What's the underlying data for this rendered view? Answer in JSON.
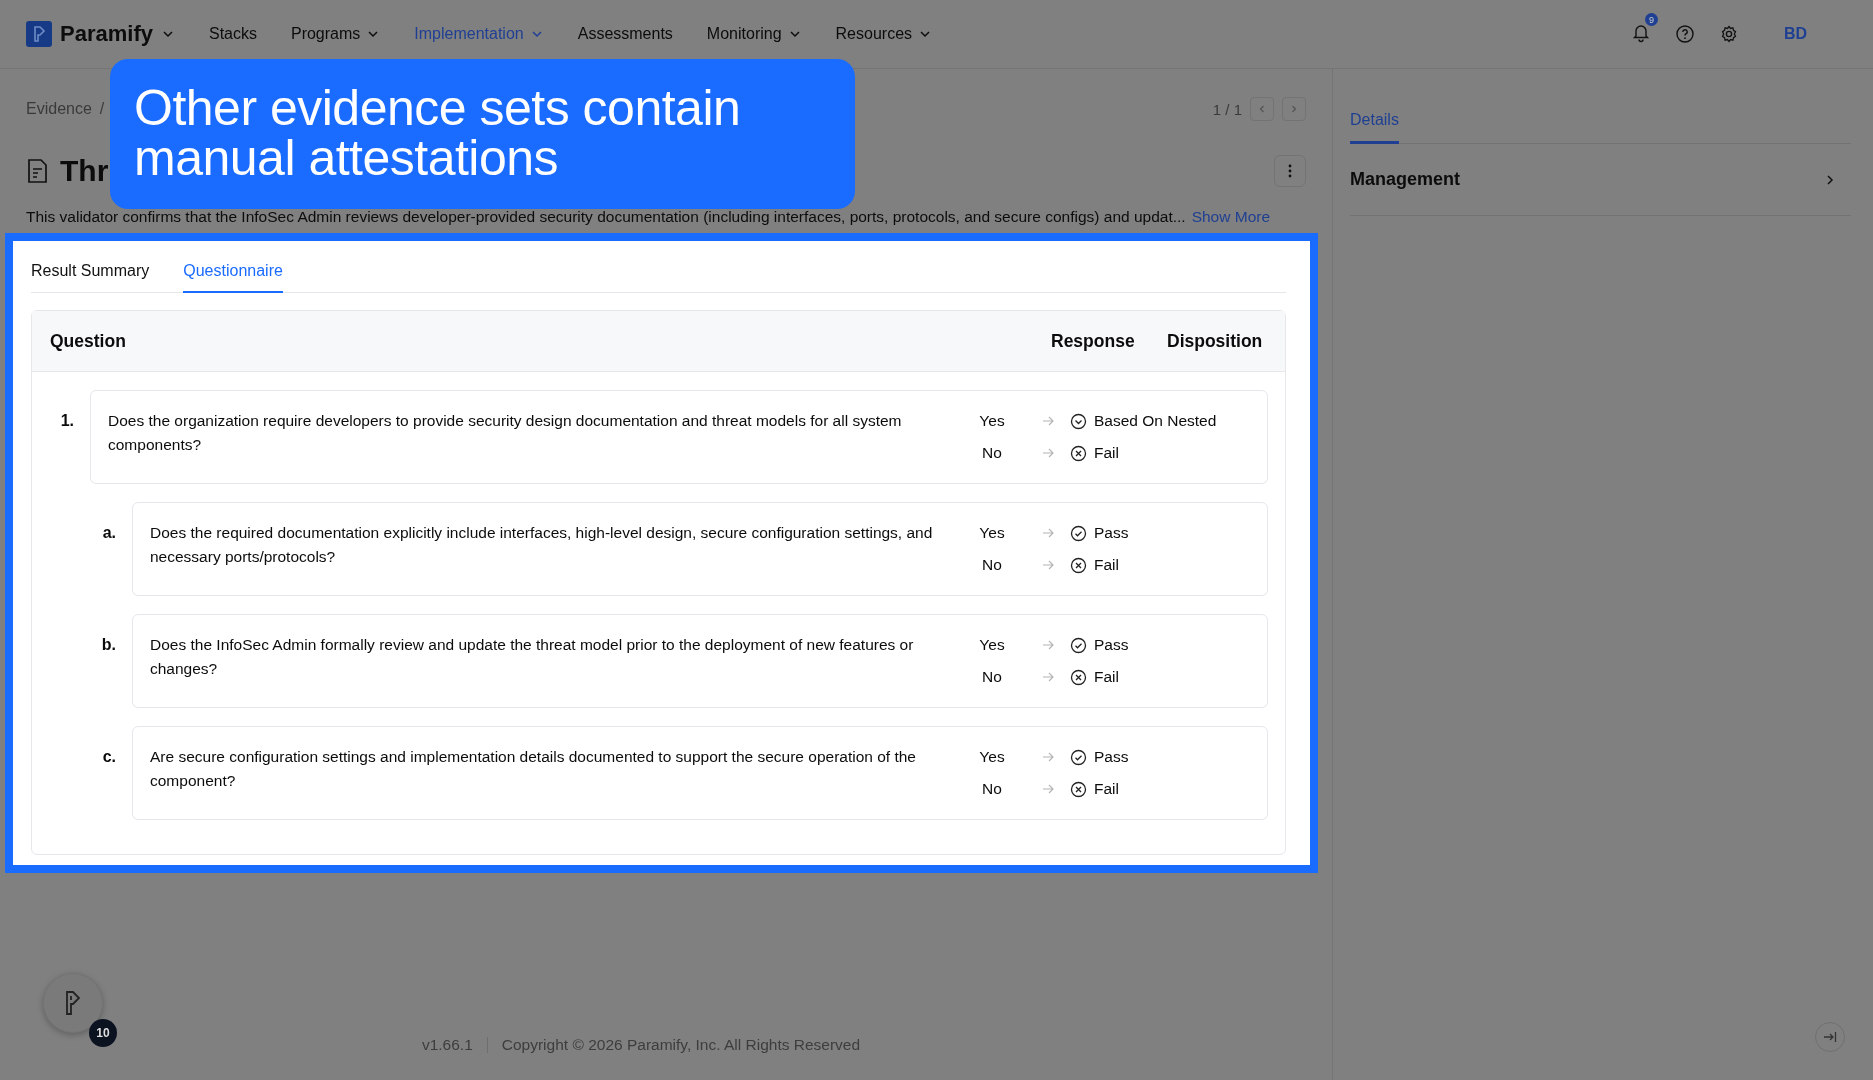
{
  "nav": {
    "brand": "Paramify",
    "items": [
      {
        "label": "Stacks",
        "dropdown": false,
        "selected": false
      },
      {
        "label": "Programs",
        "dropdown": true,
        "selected": false
      },
      {
        "label": "Implementation",
        "dropdown": true,
        "selected": true
      },
      {
        "label": "Assessments",
        "dropdown": false,
        "selected": false
      },
      {
        "label": "Monitoring",
        "dropdown": true,
        "selected": false
      },
      {
        "label": "Resources",
        "dropdown": true,
        "selected": false
      }
    ],
    "notification_count": "9",
    "avatar": "BD"
  },
  "callout": "Other evidence sets contain manual attestations",
  "breadcrumb": [
    "Evidence"
  ],
  "breadcrumb_separator": "/",
  "pager": "1 / 1",
  "title": "Thr",
  "description": "This validator confirms that the InfoSec Admin reviews developer-provided security documentation (including interfaces, ports, protocols, and secure configs) and updat...",
  "show_more": "Show More",
  "tabs": [
    {
      "label": "Result Summary",
      "selected": false
    },
    {
      "label": "Questionnaire",
      "selected": true
    }
  ],
  "table": {
    "columns": [
      "Question",
      "Response",
      "Disposition"
    ],
    "questions": [
      {
        "number": "1.",
        "text": "Does the organization require developers to provide security design documentation and threat models for all system components?",
        "responses": [
          {
            "answer": "Yes",
            "disposition": "Based On Nested",
            "kind": "nested"
          },
          {
            "answer": "No",
            "disposition": "Fail",
            "kind": "fail"
          }
        ],
        "children": [
          {
            "number": "a.",
            "text": "Does the required documentation explicitly include interfaces, high-level design, secure configuration settings, and necessary ports/protocols?",
            "responses": [
              {
                "answer": "Yes",
                "disposition": "Pass",
                "kind": "pass"
              },
              {
                "answer": "No",
                "disposition": "Fail",
                "kind": "fail"
              }
            ]
          },
          {
            "number": "b.",
            "text": "Does the InfoSec Admin formally review and update the threat model prior to the deployment of new features or changes?",
            "responses": [
              {
                "answer": "Yes",
                "disposition": "Pass",
                "kind": "pass"
              },
              {
                "answer": "No",
                "disposition": "Fail",
                "kind": "fail"
              }
            ]
          },
          {
            "number": "c.",
            "text": "Are secure configuration settings and implementation details documented to support the secure operation of the component?",
            "responses": [
              {
                "answer": "Yes",
                "disposition": "Pass",
                "kind": "pass"
              },
              {
                "answer": "No",
                "disposition": "Fail",
                "kind": "fail"
              }
            ]
          }
        ]
      }
    ]
  },
  "sidebar": {
    "tabs": [
      {
        "label": "Details",
        "selected": true
      }
    ],
    "sections": [
      {
        "label": "Management"
      }
    ]
  },
  "helper_badge": "10",
  "footer": {
    "version": "v1.66.1",
    "copyright": "Copyright © 2026 Paramify, Inc. All Rights Reserved"
  }
}
